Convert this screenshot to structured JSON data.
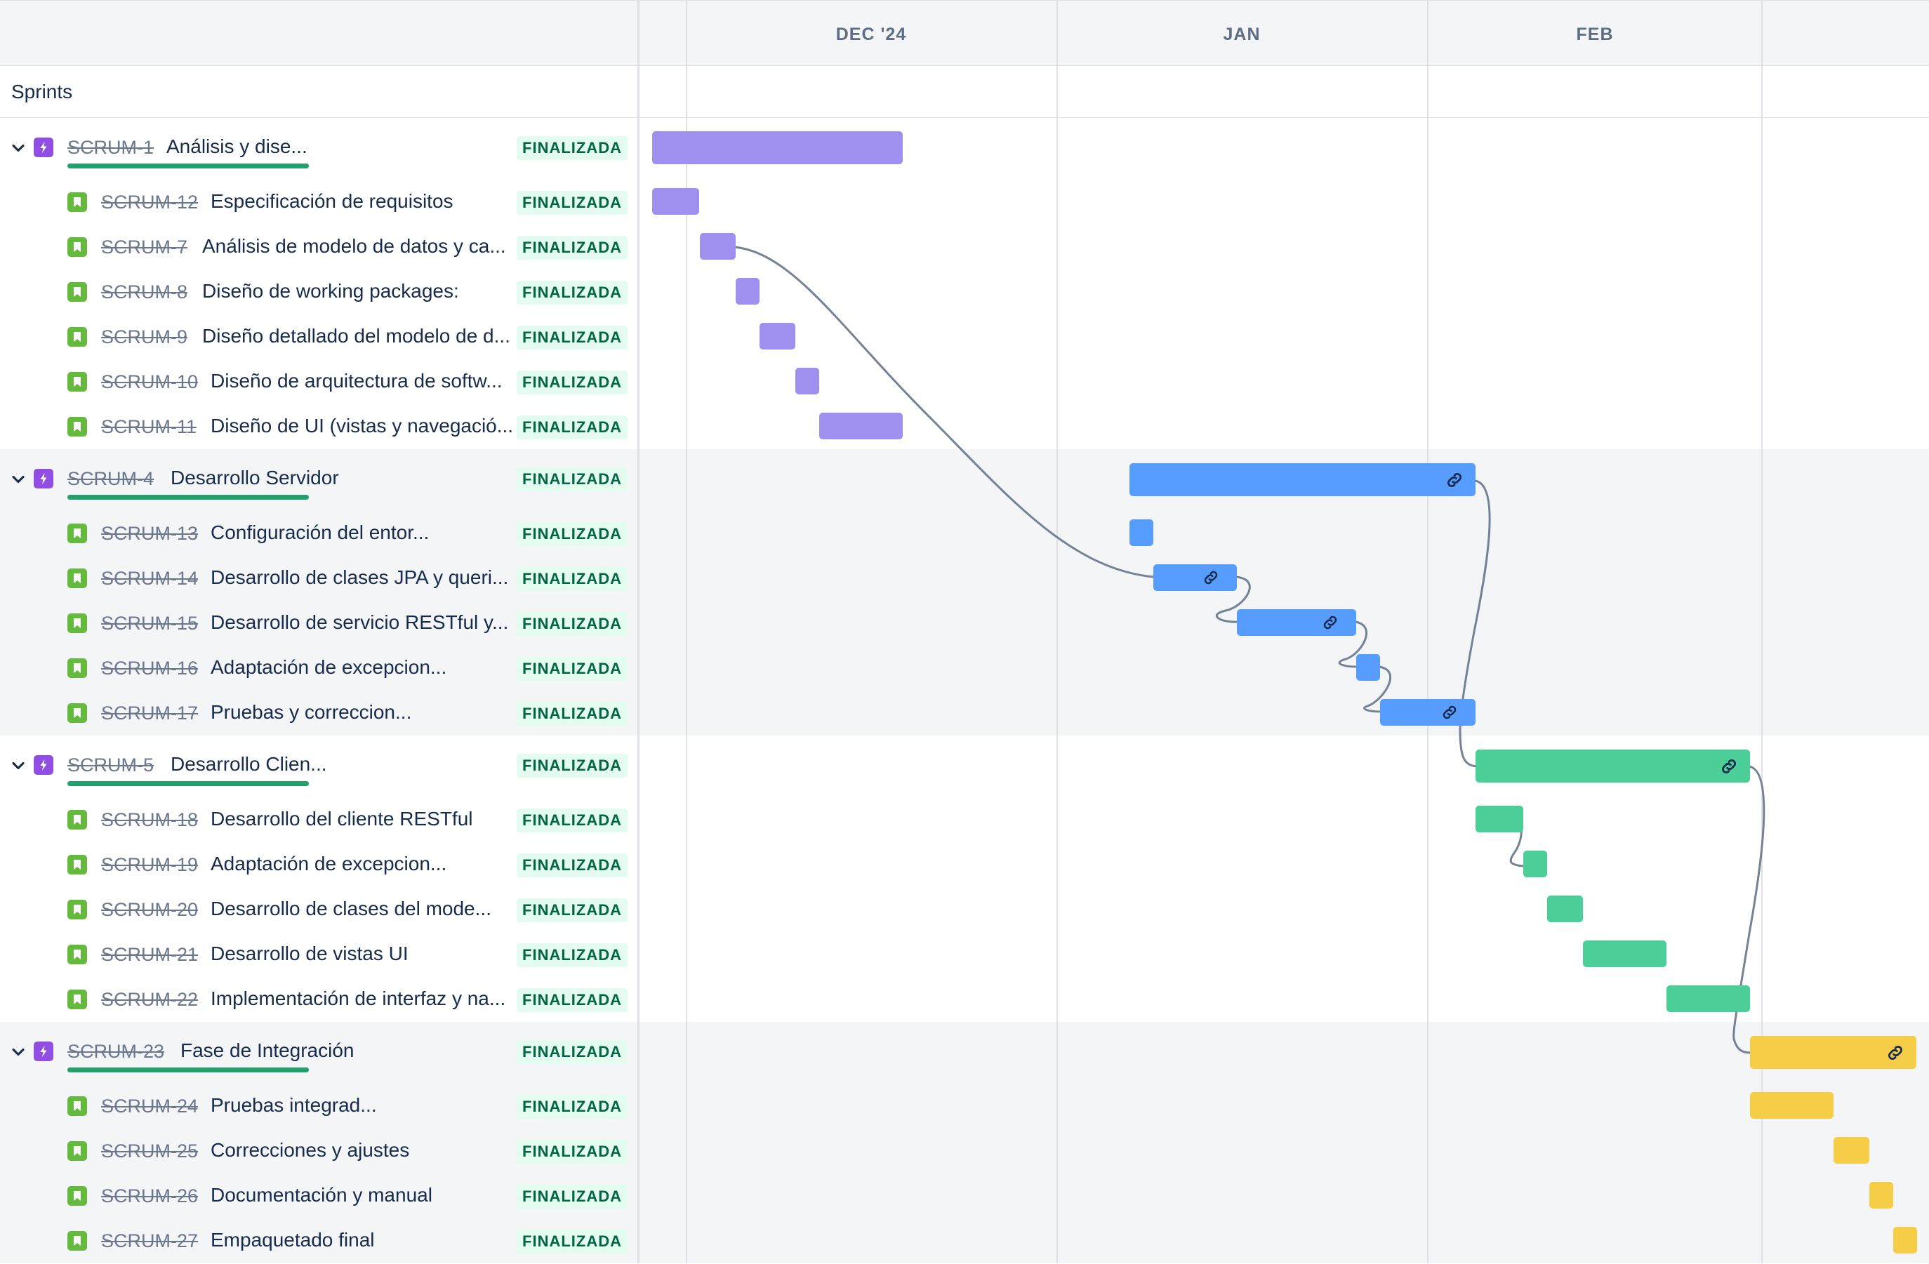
{
  "header": {
    "months": [
      "DEC '24",
      "JAN",
      "FEB"
    ],
    "sprints_label": "Sprints"
  },
  "status_label": "FINALIZADA",
  "colors": {
    "epic_1": "#9f8fef",
    "epic_2": "#579dff",
    "epic_3": "#4bce97",
    "epic_4": "#f5cd47",
    "status_bg": "#e3fcef",
    "status_text": "#006644",
    "progress": "#22a06b",
    "dependency_line": "#758195"
  },
  "epics": [
    {
      "key": "SCRUM-1",
      "summary": "Análisis y dise...",
      "status": "FINALIZADA",
      "progress": 1.0,
      "stories": [
        {
          "key": "SCRUM-12",
          "summary": "Especificación de requisitos",
          "status": "FINALIZADA"
        },
        {
          "key": "SCRUM-7",
          "summary": "Análisis de modelo de datos y ca...",
          "status": "FINALIZADA"
        },
        {
          "key": "SCRUM-8",
          "summary": "Diseño de working packages:",
          "status": "FINALIZADA"
        },
        {
          "key": "SCRUM-9",
          "summary": "Diseño detallado del modelo de d...",
          "status": "FINALIZADA"
        },
        {
          "key": "SCRUM-10",
          "summary": "Diseño de arquitectura de softw...",
          "status": "FINALIZADA"
        },
        {
          "key": "SCRUM-11",
          "summary": "Diseño de UI (vistas y navegació...",
          "status": "FINALIZADA"
        }
      ]
    },
    {
      "key": "SCRUM-4",
      "summary": "Desarrollo Servidor",
      "status": "FINALIZADA",
      "progress": 1.0,
      "stories": [
        {
          "key": "SCRUM-13",
          "summary": "Configuración del entor...",
          "status": "FINALIZADA"
        },
        {
          "key": "SCRUM-14",
          "summary": "Desarrollo de clases JPA y queri...",
          "status": "FINALIZADA"
        },
        {
          "key": "SCRUM-15",
          "summary": "Desarrollo de servicio RESTful y...",
          "status": "FINALIZADA"
        },
        {
          "key": "SCRUM-16",
          "summary": "Adaptación de excepcion...",
          "status": "FINALIZADA"
        },
        {
          "key": "SCRUM-17",
          "summary": "Pruebas y correccion...",
          "status": "FINALIZADA"
        }
      ]
    },
    {
      "key": "SCRUM-5",
      "summary": "Desarrollo Clien...",
      "status": "FINALIZADA",
      "progress": 1.0,
      "stories": [
        {
          "key": "SCRUM-18",
          "summary": "Desarrollo del cliente RESTful",
          "status": "FINALIZADA"
        },
        {
          "key": "SCRUM-19",
          "summary": "Adaptación de excepcion...",
          "status": "FINALIZADA"
        },
        {
          "key": "SCRUM-20",
          "summary": "Desarrollo de clases del mode...",
          "status": "FINALIZADA"
        },
        {
          "key": "SCRUM-21",
          "summary": "Desarrollo de vistas UI",
          "status": "FINALIZADA"
        },
        {
          "key": "SCRUM-22",
          "summary": "Implementación de interfaz y na...",
          "status": "FINALIZADA"
        }
      ]
    },
    {
      "key": "SCRUM-23",
      "summary": "Fase de Integración",
      "status": "FINALIZADA",
      "progress": 1.0,
      "stories": [
        {
          "key": "SCRUM-24",
          "summary": "Pruebas integrad...",
          "status": "FINALIZADA"
        },
        {
          "key": "SCRUM-25",
          "summary": "Correcciones y ajustes",
          "status": "FINALIZADA"
        },
        {
          "key": "SCRUM-26",
          "summary": "Documentación y manual",
          "status": "FINALIZADA"
        },
        {
          "key": "SCRUM-27",
          "summary": "Empaquetado final",
          "status": "FINALIZADA"
        }
      ]
    }
  ]
}
